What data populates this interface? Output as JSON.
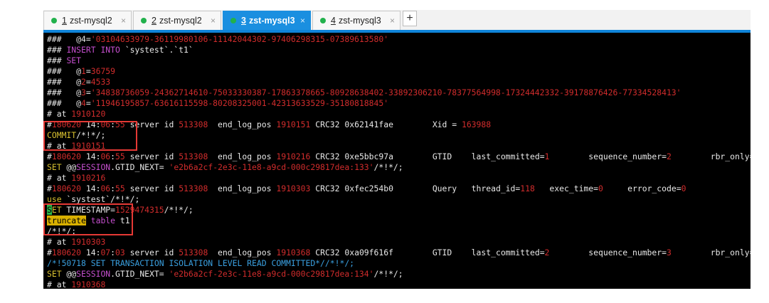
{
  "tabs": [
    {
      "num": "1",
      "label": "zst-mysql2",
      "active": false
    },
    {
      "num": "2",
      "label": "zst-mysql2",
      "active": false
    },
    {
      "num": "3",
      "label": "zst-mysql3",
      "active": true
    },
    {
      "num": "4",
      "label": "zst-mysql3",
      "active": false
    }
  ],
  "tab_close_glyph": "×",
  "new_tab_glyph": "+",
  "colors": {
    "accent": "#1a8fe0",
    "status_dot": "#22b14c",
    "highlight_box": "#e53935"
  },
  "terminal_lines": [
    [
      [
        "w",
        "###   @4="
      ],
      [
        "r",
        "'03104633979-36119980106-11142044302-97406298315-07389613580'"
      ]
    ],
    [
      [
        "w",
        "### "
      ],
      [
        "m",
        "INSERT INTO"
      ],
      [
        "w",
        " `systest`.`t1`"
      ]
    ],
    [
      [
        "w",
        "### "
      ],
      [
        "m",
        "SET"
      ]
    ],
    [
      [
        "w",
        "###   @"
      ],
      [
        "r",
        "1"
      ],
      [
        "w",
        "="
      ],
      [
        "r",
        "36759"
      ]
    ],
    [
      [
        "w",
        "###   @"
      ],
      [
        "r",
        "2"
      ],
      [
        "w",
        "="
      ],
      [
        "r",
        "4533"
      ]
    ],
    [
      [
        "w",
        "###   @"
      ],
      [
        "r",
        "3"
      ],
      [
        "w",
        "="
      ],
      [
        "r",
        "'34838736059-24362714610-75033330387-17863378665-80928638402-33892306210-78377564998-17324442332-39178876426-77334528413'"
      ]
    ],
    [
      [
        "w",
        "###   @"
      ],
      [
        "r",
        "4"
      ],
      [
        "w",
        "="
      ],
      [
        "r",
        "'11946195857-63616115598-80208325001-42313633529-35180818845'"
      ]
    ],
    [
      [
        "w",
        "# at "
      ],
      [
        "r",
        "1910120"
      ]
    ],
    [
      [
        "w",
        "#"
      ],
      [
        "r",
        "180620"
      ],
      [
        "w",
        " 14:"
      ],
      [
        "r",
        "06"
      ],
      [
        "w",
        ":"
      ],
      [
        "r",
        "55"
      ],
      [
        "w",
        " server id "
      ],
      [
        "r",
        "513308"
      ],
      [
        "w",
        "  end_log_pos "
      ],
      [
        "r",
        "1910151"
      ],
      [
        "w",
        " CRC32 0x62141fae        Xid = "
      ],
      [
        "r",
        "163988"
      ]
    ],
    [
      [
        "y",
        "COMMIT"
      ],
      [
        "w",
        "/*!*/;"
      ]
    ],
    [
      [
        "w",
        "# at "
      ],
      [
        "r",
        "1910151"
      ]
    ],
    [
      [
        "w",
        "#"
      ],
      [
        "r",
        "180620"
      ],
      [
        "w",
        " 14:"
      ],
      [
        "r",
        "06"
      ],
      [
        "w",
        ":"
      ],
      [
        "r",
        "55"
      ],
      [
        "w",
        " server id "
      ],
      [
        "r",
        "513308"
      ],
      [
        "w",
        "  end_log_pos "
      ],
      [
        "r",
        "1910216"
      ],
      [
        "w",
        " CRC32 0xe5bbc97a        GTID    last_committed="
      ],
      [
        "r",
        "1"
      ],
      [
        "w",
        "        sequence_number="
      ],
      [
        "r",
        "2"
      ],
      [
        "w",
        "        rbr_only=no"
      ]
    ],
    [
      [
        "y",
        "SET"
      ],
      [
        "w",
        " @@"
      ],
      [
        "m",
        "SESSION"
      ],
      [
        "w",
        ".GTID_NEXT= "
      ],
      [
        "r",
        "'e2b6a2cf-2e3c-11e8-a9cd-000c29817dea:133'"
      ],
      [
        "w",
        "/*!*/;"
      ]
    ],
    [
      [
        "w",
        "# at "
      ],
      [
        "r",
        "1910216"
      ]
    ],
    [
      [
        "w",
        "#"
      ],
      [
        "r",
        "180620"
      ],
      [
        "w",
        " 14:"
      ],
      [
        "r",
        "06"
      ],
      [
        "w",
        ":"
      ],
      [
        "r",
        "55"
      ],
      [
        "w",
        " server id "
      ],
      [
        "r",
        "513308"
      ],
      [
        "w",
        "  end_log_pos "
      ],
      [
        "r",
        "1910303"
      ],
      [
        "w",
        " CRC32 0xfec254b0        Query   thread_id="
      ],
      [
        "r",
        "118"
      ],
      [
        "w",
        "   exec_time="
      ],
      [
        "r",
        "0"
      ],
      [
        "w",
        "     error_code="
      ],
      [
        "r",
        "0"
      ]
    ],
    [
      [
        "y",
        "use"
      ],
      [
        "w",
        " `systest`/*!*/;"
      ]
    ],
    [
      [
        "hlg",
        "S"
      ],
      [
        "y",
        "ET"
      ],
      [
        "w",
        " TIMESTAMP="
      ],
      [
        "r",
        "1529474315"
      ],
      [
        "w",
        "/*!*/;"
      ]
    ],
    [
      [
        "hl",
        "truncate"
      ],
      [
        "w",
        " "
      ],
      [
        "m",
        "table"
      ],
      [
        "w",
        " t1"
      ]
    ],
    [
      [
        "w",
        "/*!*/;"
      ]
    ],
    [
      [
        "w",
        "# at "
      ],
      [
        "r",
        "1910303"
      ]
    ],
    [
      [
        "w",
        "#"
      ],
      [
        "r",
        "180620"
      ],
      [
        "w",
        " 14:"
      ],
      [
        "r",
        "07"
      ],
      [
        "w",
        ":"
      ],
      [
        "r",
        "03"
      ],
      [
        "w",
        " server id "
      ],
      [
        "r",
        "513308"
      ],
      [
        "w",
        "  end_log_pos "
      ],
      [
        "r",
        "1910368"
      ],
      [
        "w",
        " CRC32 0xa09f616f        GTID    last_committed="
      ],
      [
        "r",
        "2"
      ],
      [
        "w",
        "        sequence_number="
      ],
      [
        "r",
        "3"
      ],
      [
        "w",
        "        rbr_only=no"
      ]
    ],
    [
      [
        "c",
        "/*!50718 SET TRANSACTION ISOLATION LEVEL READ COMMITTED*//*!*/;"
      ]
    ],
    [
      [
        "y",
        "SET"
      ],
      [
        "w",
        " @@"
      ],
      [
        "m",
        "SESSION"
      ],
      [
        "w",
        ".GTID_NEXT= "
      ],
      [
        "r",
        "'e2b6a2cf-2e3c-11e8-a9cd-000c29817dea:134'"
      ],
      [
        "w",
        "/*!*/;"
      ]
    ],
    [
      [
        "w",
        "# at "
      ],
      [
        "r",
        "1910368"
      ]
    ]
  ]
}
